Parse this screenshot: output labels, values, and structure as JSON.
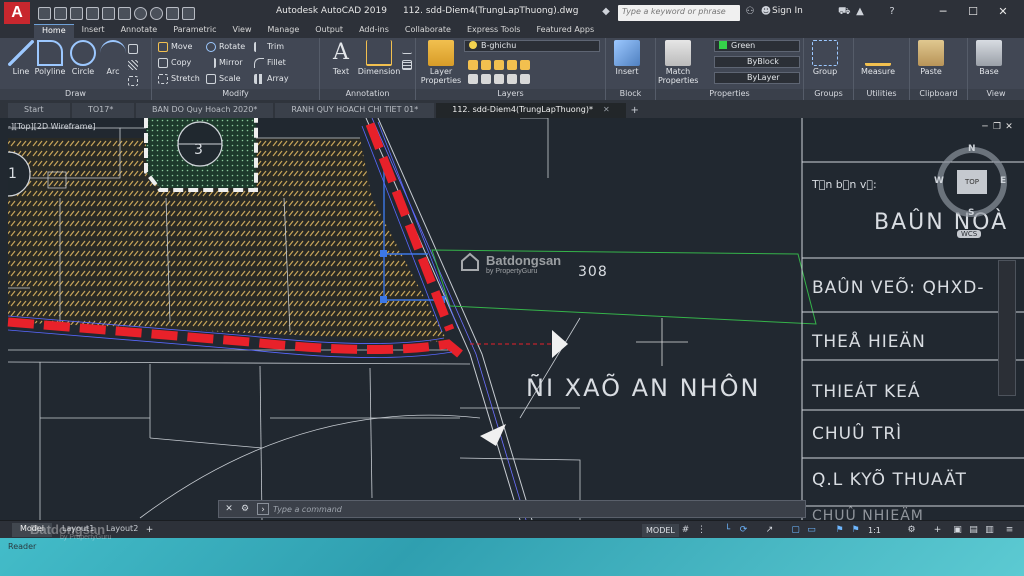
{
  "titlebar": {
    "app_name": "Autodesk AutoCAD 2019",
    "file_name": "112. sdd-Diem4(TrungLapThuong).dwg",
    "search_placeholder": "Type a keyword or phrase",
    "sign_in": "Sign In",
    "logo_letter": "A"
  },
  "ribbon_tabs": [
    "Home",
    "Insert",
    "Annotate",
    "Parametric",
    "View",
    "Manage",
    "Output",
    "Add-ins",
    "Collaborate",
    "Express Tools",
    "Featured Apps"
  ],
  "ribbon": {
    "draw": {
      "title": "Draw",
      "tools": [
        "Line",
        "Polyline",
        "Circle",
        "Arc"
      ]
    },
    "modify": {
      "title": "Modify",
      "tools": [
        "Move",
        "Rotate",
        "Trim",
        "Copy",
        "Mirror",
        "Fillet",
        "Stretch",
        "Scale",
        "Array"
      ]
    },
    "annotation": {
      "title": "Annotation",
      "tools": [
        "Text",
        "Dimension"
      ]
    },
    "layers": {
      "title": "Layers",
      "tool": "Layer Properties",
      "current_layer": "B-ghichu"
    },
    "block": {
      "title": "Block",
      "tool": "Insert"
    },
    "properties": {
      "title": "Properties",
      "tool": "Match Properties",
      "color": "Green",
      "linetype": "ByBlock",
      "lineweight": "ByLayer"
    },
    "groups": {
      "title": "Groups",
      "tool": "Group"
    },
    "utilities": {
      "title": "Utilities",
      "tool": "Measure"
    },
    "clipboard": {
      "title": "Clipboard",
      "tool": "Paste"
    },
    "view": {
      "title": "View",
      "tool": "Base"
    }
  },
  "file_tabs": [
    "Start",
    "TO17*",
    "BAN DO Quy Hoach 2020*",
    "RANH QUY HOACH CHI TIET 01*",
    "112. sdd-Diem4(TrungLapThuong)*"
  ],
  "viewport": {
    "label": "-][Top][2D Wireframe]"
  },
  "viewcube": {
    "n": "N",
    "s": "S",
    "e": "E",
    "w": "W",
    "top": "TOP",
    "wcs": "WCS"
  },
  "drawing_text": {
    "circle_label": "3",
    "circle_label_left": "1",
    "parcel_number": "308",
    "place_name": "ÑI XAÕ AN NHÔN",
    "title_block": {
      "unit_label": "T\u0000n b\u0000n v\u0000:",
      "ban_noa": "BAÛN NOÀ",
      "ban_ve": "BAÛN VEÕ: QHXD-",
      "the_hien": "THEÅ HIEÄN",
      "thiet_ke": "THIEÁT KEÁ",
      "chu_tri": "CHUÛ TRÌ",
      "ql_ky_thuat": "Q.L KYÕ THUAÄT",
      "chu_nhiem": "CHUÛ NHIEÄM"
    }
  },
  "watermark": {
    "brand": "Batdongsan",
    "sub": "by PropertyGuru"
  },
  "command_line": {
    "placeholder": "Type a command"
  },
  "status": {
    "layout_tabs": [
      "Model",
      "Layout1",
      "Layout2"
    ],
    "model_label": "MODEL",
    "scale": "1:1"
  },
  "footer": {
    "label": "Reader"
  },
  "colors": {
    "accent_red": "#e8212a",
    "parcel_green": "#35b34a",
    "selection_blue": "#3c78e6",
    "grid_yellow": "#c8a55a"
  }
}
